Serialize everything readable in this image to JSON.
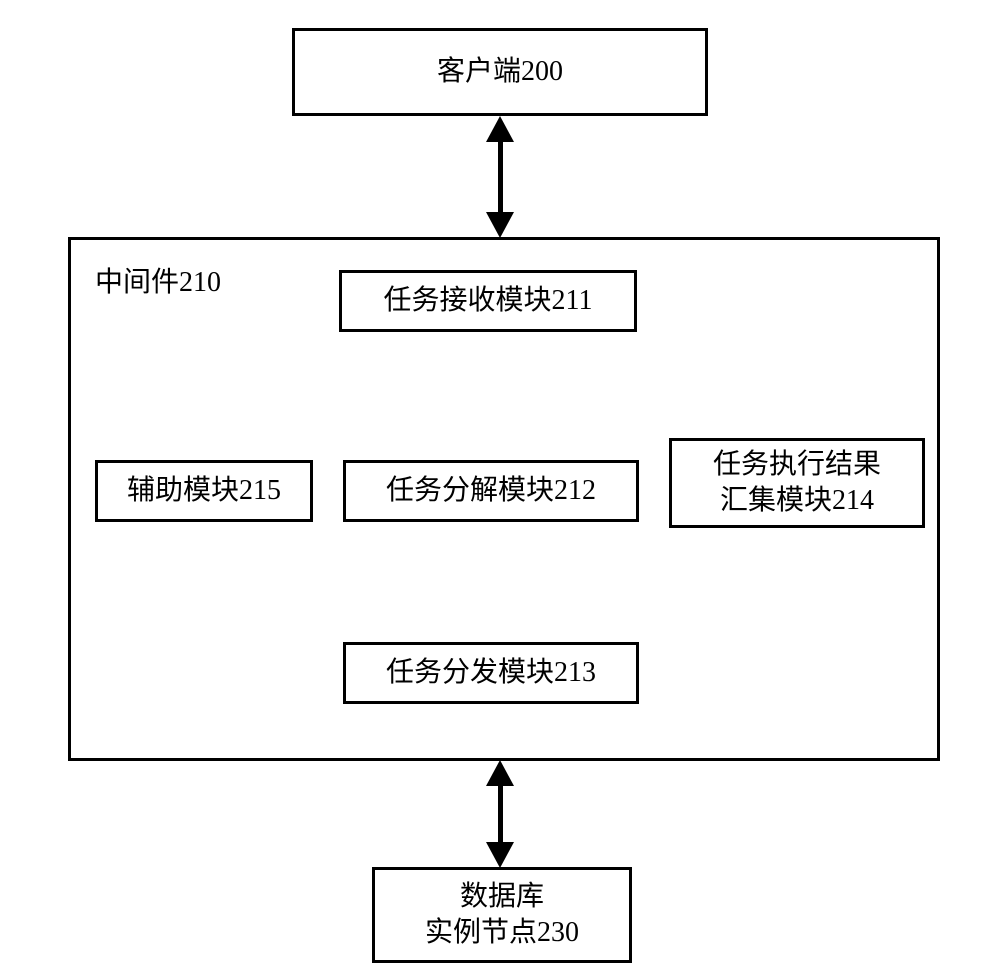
{
  "client": {
    "label": "客户端200"
  },
  "middleware": {
    "label": "中间件210",
    "modules": {
      "receive": "任务接收模块211",
      "auxiliary": "辅助模块215",
      "decompose": "任务分解模块212",
      "result": "任务执行结果\n汇集模块214",
      "dispatch": "任务分发模块213"
    }
  },
  "database": {
    "label": "数据库\n实例节点230"
  }
}
